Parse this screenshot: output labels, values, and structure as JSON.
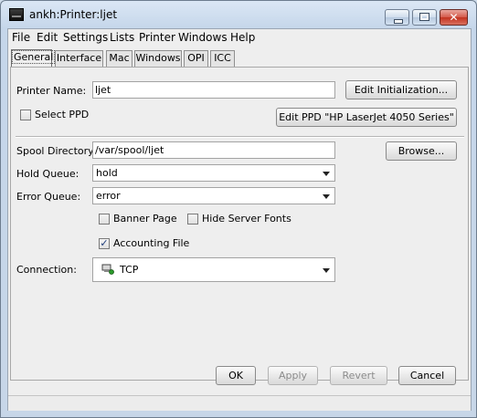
{
  "window": {
    "title": "ankh:Printer:ljet"
  },
  "menubar": {
    "items": [
      "File",
      "Edit",
      "Settings",
      "Lists",
      "Printer",
      "Windows",
      "Help"
    ]
  },
  "tabs": [
    "General",
    "Interface",
    "Mac",
    "Windows",
    "OPI",
    "ICC"
  ],
  "general": {
    "printer_name_label": "Printer Name:",
    "printer_name_value": "ljet",
    "edit_init_label": "Edit Initialization...",
    "select_ppd_label": "Select PPD",
    "select_ppd_checked": false,
    "edit_ppd_label": "Edit PPD \"HP LaserJet 4050 Series\"",
    "spool_dir_label": "Spool Directory:",
    "spool_dir_value": "/var/spool/ljet",
    "browse_label": "Browse...",
    "hold_queue_label": "Hold Queue:",
    "hold_queue_value": "hold",
    "error_queue_label": "Error Queue:",
    "error_queue_value": "error",
    "banner_page_label": "Banner Page",
    "banner_page_checked": false,
    "hide_fonts_label": "Hide Server Fonts",
    "hide_fonts_checked": false,
    "accounting_label": "Accounting File",
    "accounting_checked": true,
    "connection_label": "Connection:",
    "connection_value": "TCP",
    "connection_icon": "network-connection-icon"
  },
  "footer": {
    "ok_label": "OK",
    "apply_label": "Apply",
    "revert_label": "Revert",
    "cancel_label": "Cancel"
  }
}
